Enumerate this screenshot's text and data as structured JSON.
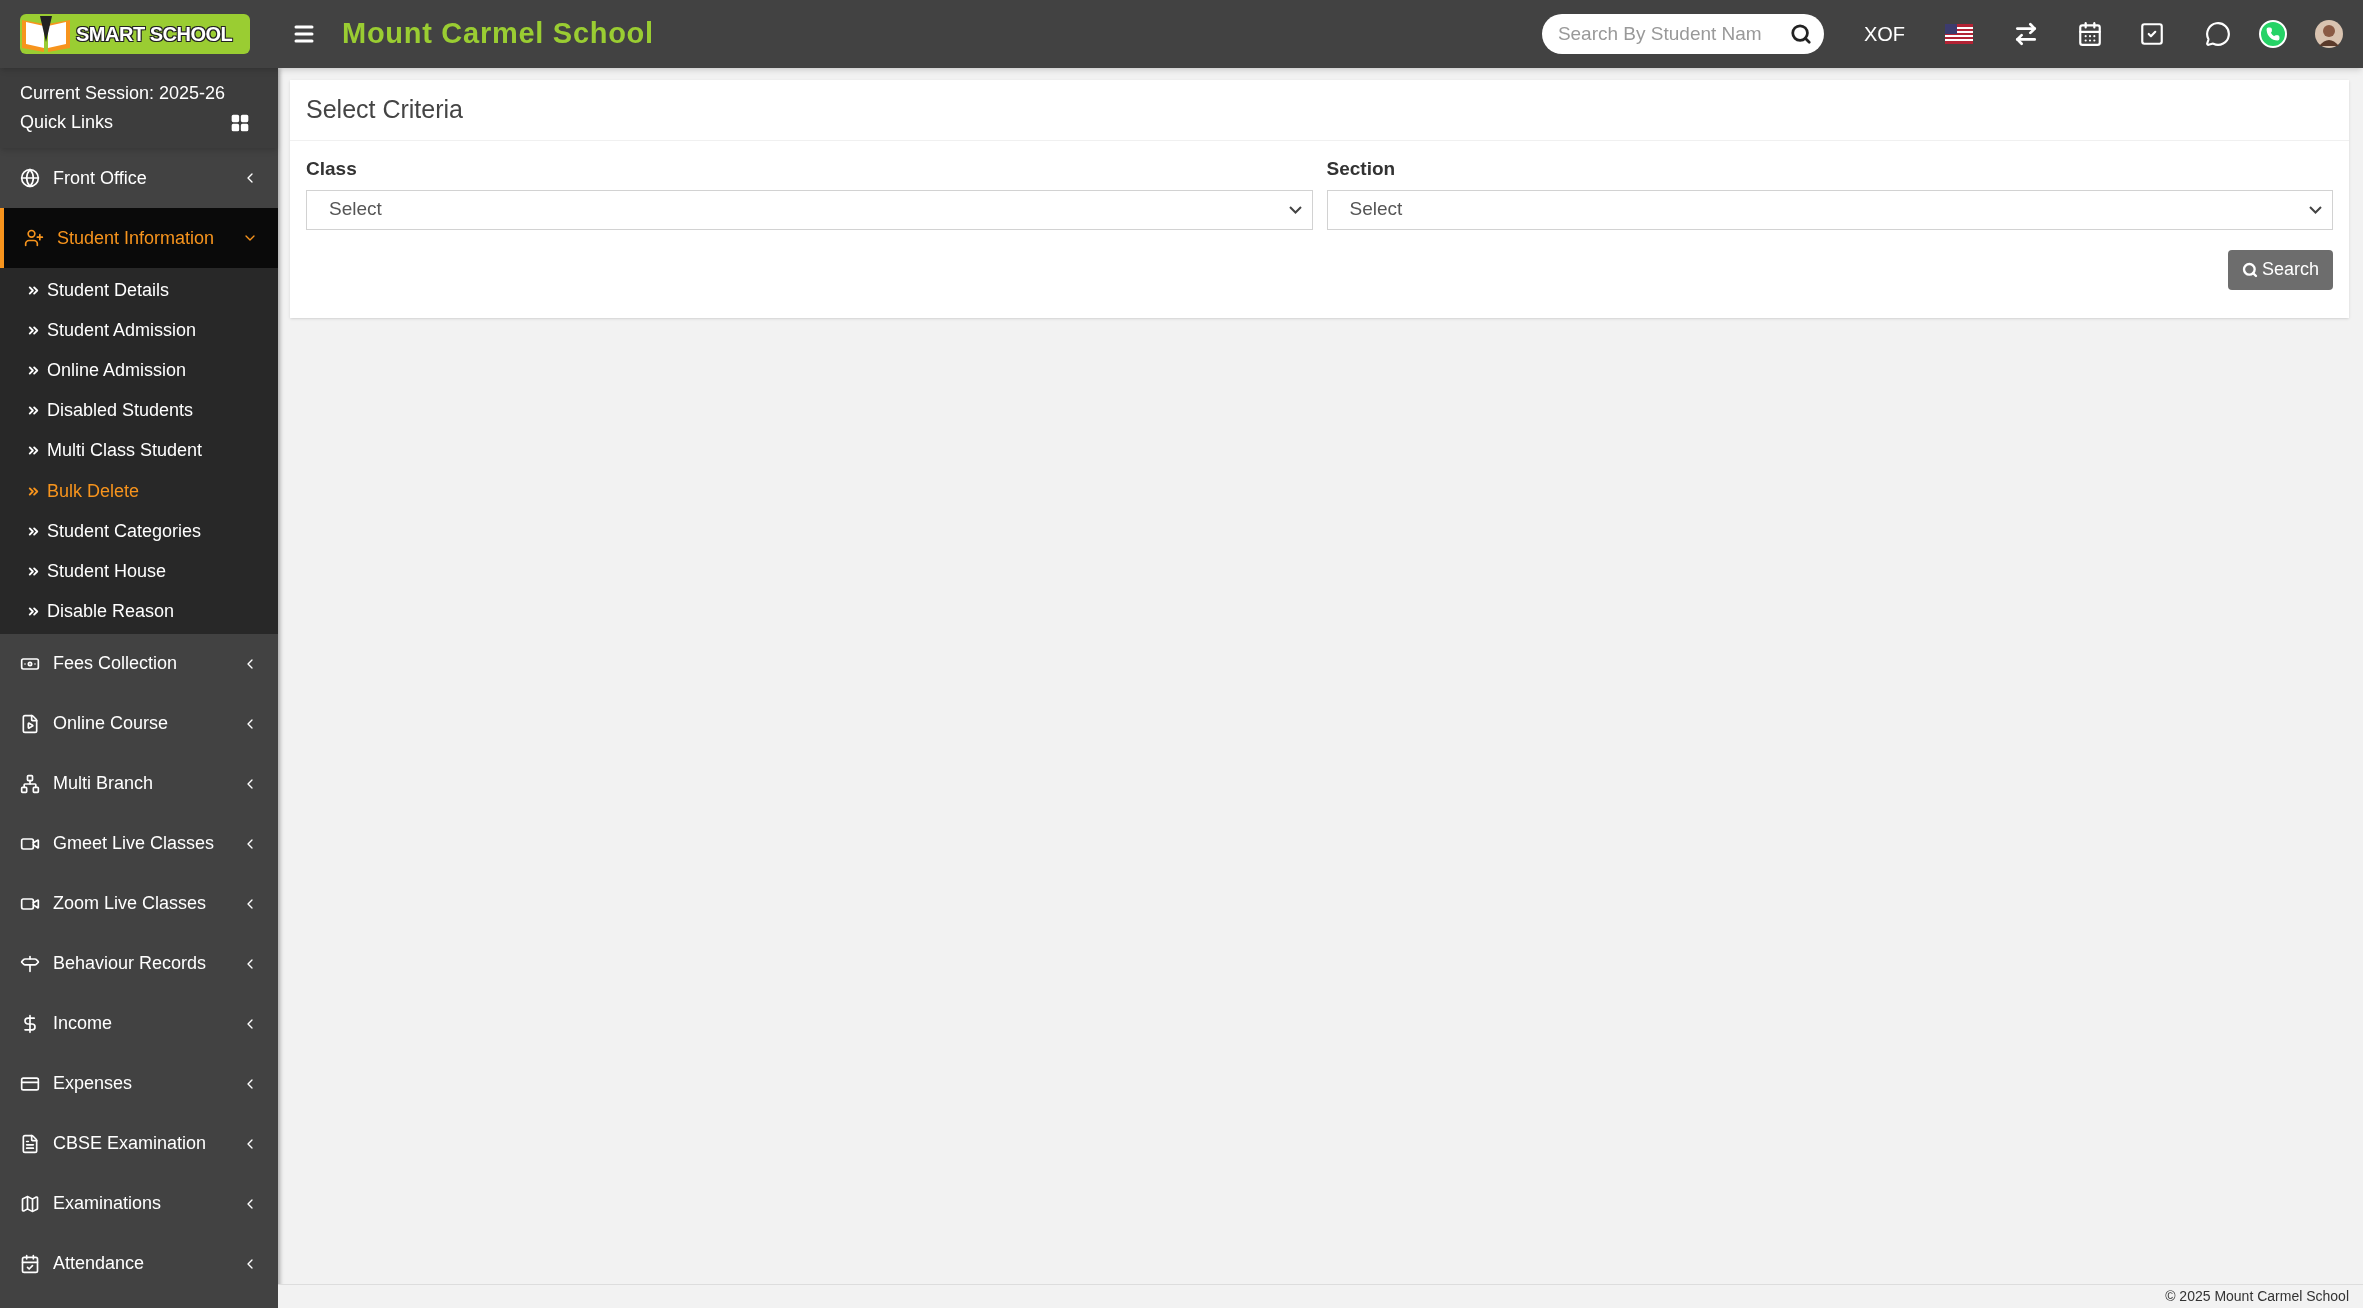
{
  "header": {
    "logo_text": "SMART SCHOOL",
    "school_name": "Mount Carmel School",
    "search": {
      "placeholder": "Search By Student Nam"
    },
    "currency": "XOF"
  },
  "sidebar": {
    "session": "Current Session: 2025-26",
    "quick_links": "Quick Links",
    "items": [
      {
        "label": "Front Office",
        "expanded": false
      },
      {
        "label": "Student Information",
        "expanded": true,
        "children": [
          {
            "label": "Student Details",
            "selected": false
          },
          {
            "label": "Student Admission",
            "selected": false
          },
          {
            "label": "Online Admission",
            "selected": false
          },
          {
            "label": "Disabled Students",
            "selected": false
          },
          {
            "label": "Multi Class Student",
            "selected": false
          },
          {
            "label": "Bulk Delete",
            "selected": true
          },
          {
            "label": "Student Categories",
            "selected": false
          },
          {
            "label": "Student House",
            "selected": false
          },
          {
            "label": "Disable Reason",
            "selected": false
          }
        ]
      },
      {
        "label": "Fees Collection",
        "expanded": false
      },
      {
        "label": "Online Course",
        "expanded": false
      },
      {
        "label": "Multi Branch",
        "expanded": false
      },
      {
        "label": "Gmeet Live Classes",
        "expanded": false
      },
      {
        "label": "Zoom Live Classes",
        "expanded": false
      },
      {
        "label": "Behaviour Records",
        "expanded": false
      },
      {
        "label": "Income",
        "expanded": false
      },
      {
        "label": "Expenses",
        "expanded": false
      },
      {
        "label": "CBSE Examination",
        "expanded": false
      },
      {
        "label": "Examinations",
        "expanded": false
      },
      {
        "label": "Attendance",
        "expanded": false
      }
    ]
  },
  "card": {
    "title": "Select Criteria",
    "fields": [
      {
        "label": "Class",
        "value": "Select"
      },
      {
        "label": "Section",
        "value": "Select"
      }
    ],
    "button": "Search"
  },
  "footer": "© 2025 Mount Carmel School"
}
